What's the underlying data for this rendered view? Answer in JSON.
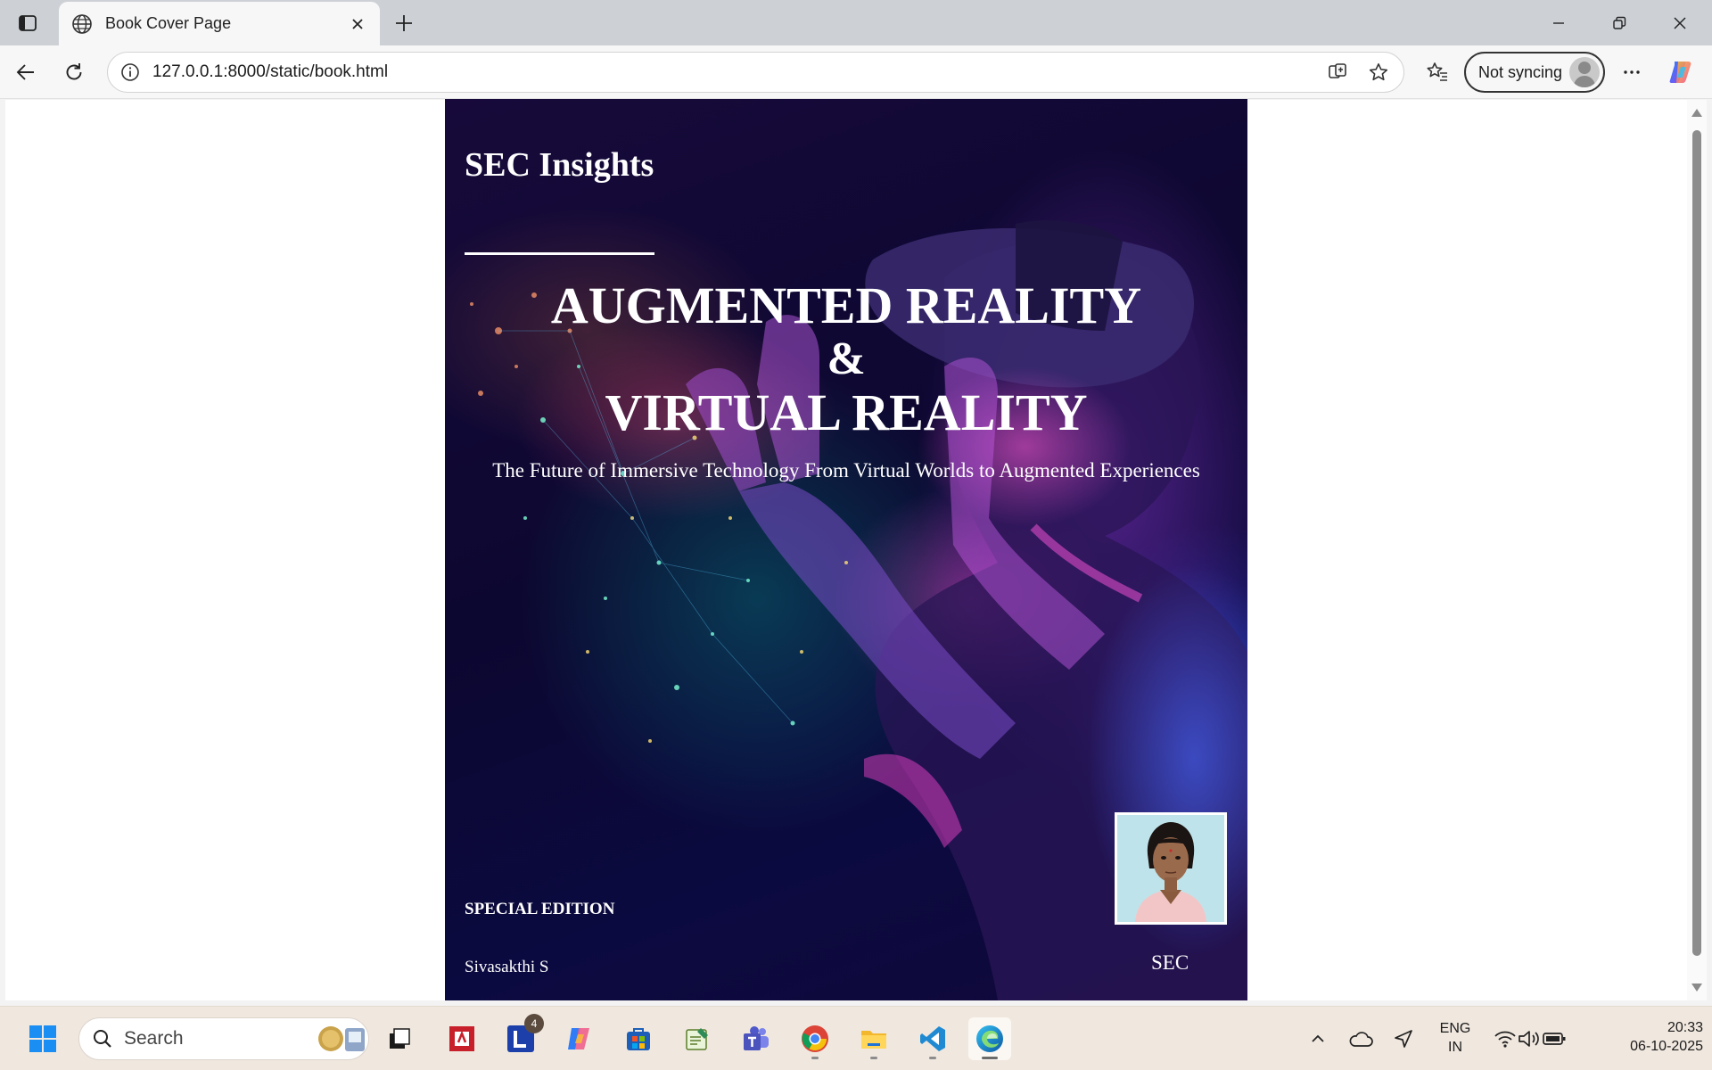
{
  "browser": {
    "tab_title": "Book Cover Page",
    "url": "127.0.0.1:8000/static/book.html",
    "profile_label": "Not syncing"
  },
  "cover": {
    "brand": "SEC Insights",
    "title_line1": "AUGMENTED REALITY",
    "title_line2": "&",
    "title_line3": "VIRTUAL REALITY",
    "subtitle": "The Future of Immersive Technology From Virtual Worlds to Augmented Experiences",
    "edition": "SPECIAL EDITION",
    "author": "Sivasakthi S",
    "organization": "SEC"
  },
  "taskbar": {
    "search_label": "Search",
    "lexi_badge": "4",
    "language_line1": "ENG",
    "language_line2": "IN",
    "time": "20:33",
    "date": "06-10-2025"
  },
  "colors": {
    "cover_background": "#0c0730",
    "accent_magenta": "#ff46d2",
    "accent_blue": "#3c50ff",
    "taskbar": "#f0e8df"
  }
}
